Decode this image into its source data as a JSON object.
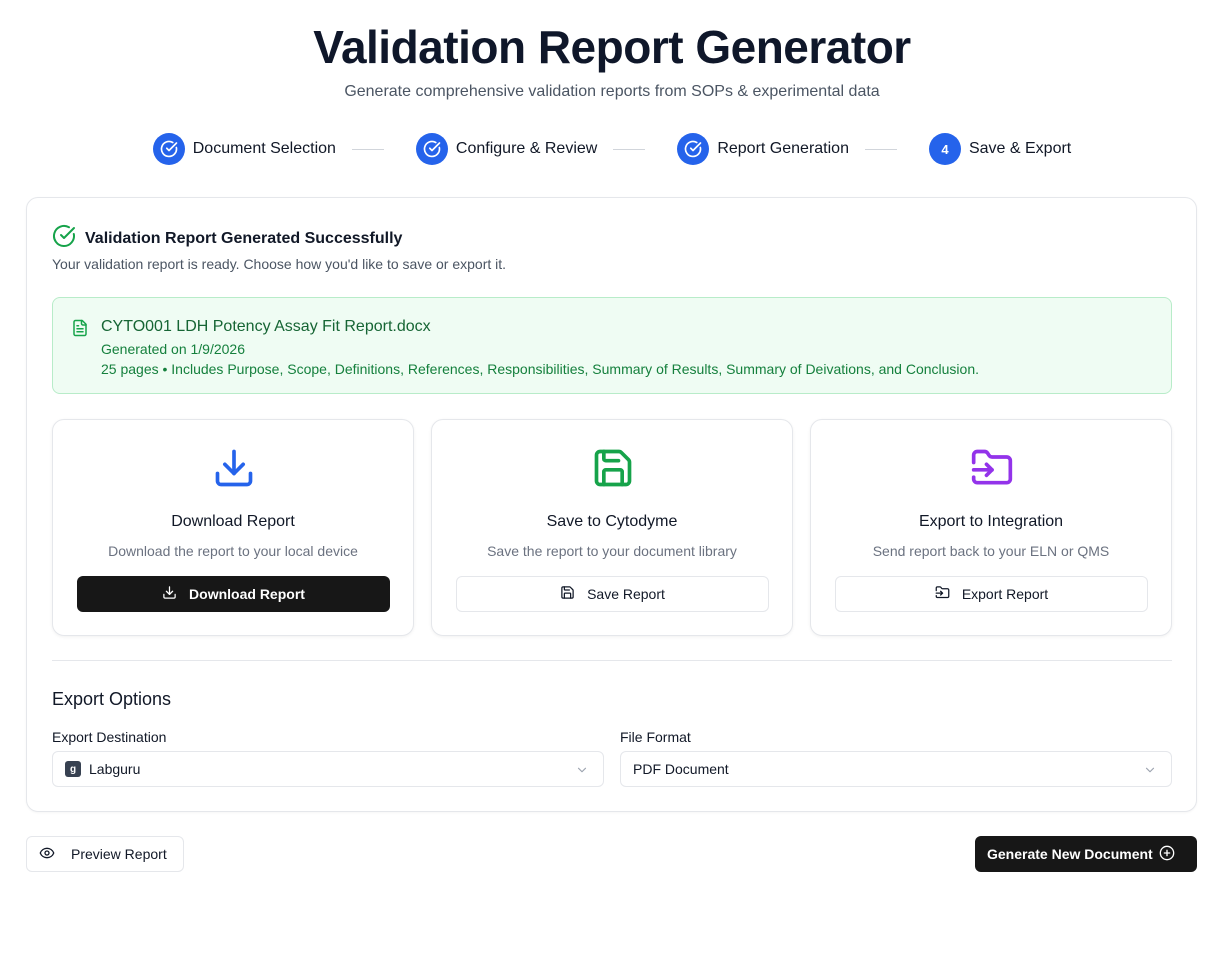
{
  "header": {
    "title": "Validation Report Generator",
    "subtitle": "Generate comprehensive validation reports from SOPs & experimental data"
  },
  "steps": [
    {
      "label": "Document Selection",
      "status": "complete"
    },
    {
      "label": "Configure & Review",
      "status": "complete"
    },
    {
      "label": "Report Generation",
      "status": "complete"
    },
    {
      "label": "Save & Export",
      "status": "current",
      "number": "4"
    }
  ],
  "success": {
    "title": "Validation Report Generated Successfully",
    "description": "Your validation report is ready. Choose how you'd like to save or export it."
  },
  "file": {
    "name": "CYTO001 LDH Potency Assay Fit Report.docx",
    "generated": "Generated on 1/9/2026",
    "meta": "25 pages • Includes Purpose, Scope, Definitions, References, Responsibilities, Summary of Results, Summary of Deivations, and Conclusion."
  },
  "options": [
    {
      "title": "Download Report",
      "description": "Download the report to your local device",
      "button": "Download Report",
      "icon": "download-icon",
      "color": "#2563eb"
    },
    {
      "title": "Save to Cytodyme",
      "description": "Save the report to your document library",
      "button": "Save Report",
      "icon": "save-icon",
      "color": "#16a34a"
    },
    {
      "title": "Export to Integration",
      "description": "Send report back to your ELN or QMS",
      "button": "Export Report",
      "icon": "folder-export-icon",
      "color": "#9333ea"
    }
  ],
  "export": {
    "title": "Export Options",
    "destination_label": "Export Destination",
    "destination_value": "Labguru",
    "format_label": "File Format",
    "format_value": "PDF Document"
  },
  "footer": {
    "preview": "Preview Report",
    "generate": "Generate New Document"
  }
}
